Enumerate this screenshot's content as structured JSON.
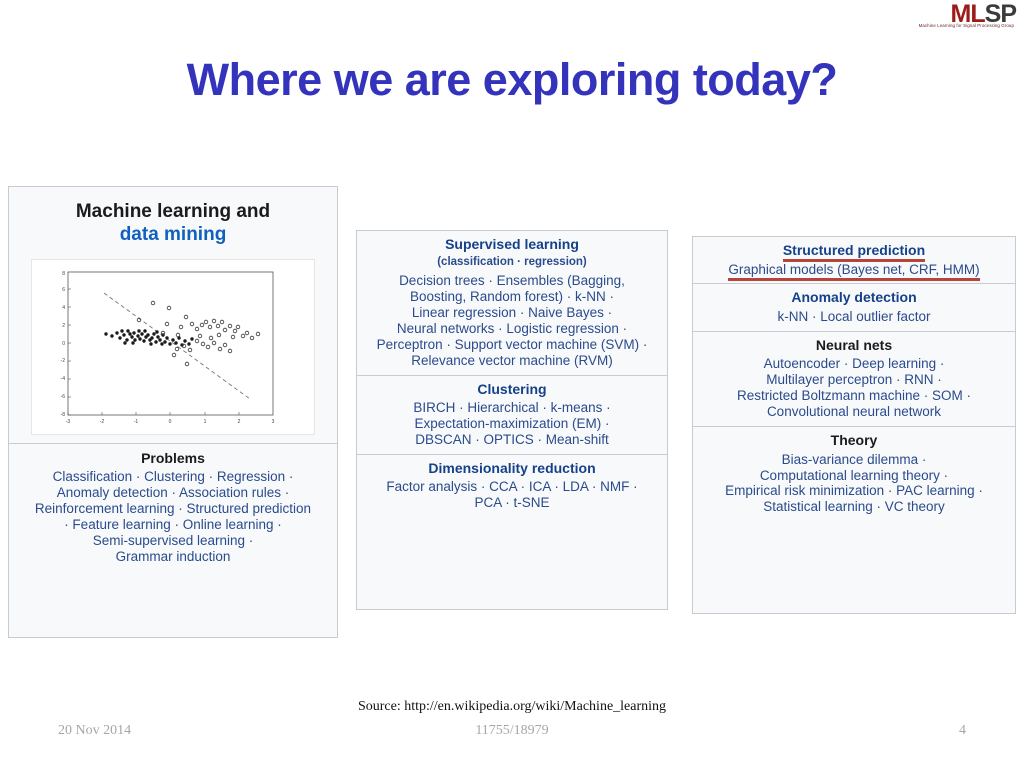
{
  "logo": {
    "part1": "ML",
    "part2": "SP",
    "tagline": "Machine Learning for Signal Processing Group"
  },
  "title": "Where we are exploring today?",
  "infobox": {
    "left_panel": {
      "title_line1": "Machine learning and",
      "title_line2": "data mining",
      "figure": {
        "type": "scatter",
        "x_ticks": [
          "-3",
          "-2",
          "-1",
          "0",
          "1",
          "2",
          "3"
        ],
        "y_ticks": [
          "-8",
          "-6",
          "-4",
          "-2",
          "0",
          "2",
          "4",
          "6",
          "8"
        ],
        "description": "scatter plot with dashed decision boundary"
      },
      "problems": {
        "heading": "Problems",
        "lines": [
          "Classification · Clustering · Regression ·",
          "Anomaly detection · Association rules ·",
          "Reinforcement learning · Structured prediction",
          "· Feature learning · Online learning ·",
          "Semi-supervised learning ·",
          "Grammar induction"
        ]
      }
    },
    "middle_panel": {
      "sections": [
        {
          "heading": "Supervised learning",
          "subheading": "(classification · regression)",
          "lines": [
            "Decision trees · Ensembles (Bagging,",
            "Boosting, Random forest) · k-NN ·",
            "Linear regression · Naive Bayes ·",
            "Neural networks · Logistic regression ·",
            "Perceptron · Support vector machine (SVM) ·",
            "Relevance vector machine (RVM)"
          ]
        },
        {
          "heading": "Clustering",
          "lines": [
            "BIRCH · Hierarchical · k-means ·",
            "Expectation-maximization (EM) ·",
            "DBSCAN · OPTICS · Mean-shift"
          ]
        },
        {
          "heading": "Dimensionality reduction",
          "lines": [
            "Factor analysis · CCA · ICA · LDA · NMF ·",
            "PCA · t-SNE"
          ]
        }
      ]
    },
    "right_panel": {
      "sections": [
        {
          "heading": "Structured prediction",
          "highlighted": true,
          "lines": [
            "Graphical models (Bayes net, CRF, HMM)"
          ]
        },
        {
          "heading": "Anomaly detection",
          "lines": [
            "k-NN · Local outlier factor"
          ]
        },
        {
          "heading": "Neural nets",
          "lines": [
            "Autoencoder · Deep learning ·",
            "Multilayer perceptron · RNN ·",
            "Restricted Boltzmann machine · SOM ·",
            "Convolutional neural network"
          ]
        },
        {
          "heading": "Theory",
          "lines": [
            "Bias-variance dilemma ·",
            "Computational learning theory ·",
            "Empirical risk minimization · PAC learning ·",
            "Statistical learning · VC theory"
          ]
        }
      ]
    }
  },
  "footer": {
    "source": "Source: http://en.wikipedia.org/wiki/Machine_learning",
    "date": "20 Nov 2014",
    "course": "11755/18979",
    "page": "4"
  },
  "colors": {
    "title_blue": "#3333bb",
    "link_blue": "#2a4b8d",
    "heading_blue": "#14418a",
    "highlight_red": "#b5443a",
    "logo_red": "#9c1c18",
    "panel_bg": "#f8f9fa",
    "panel_border": "#c8ccd1",
    "footer_gray": "#a6a6a6"
  }
}
